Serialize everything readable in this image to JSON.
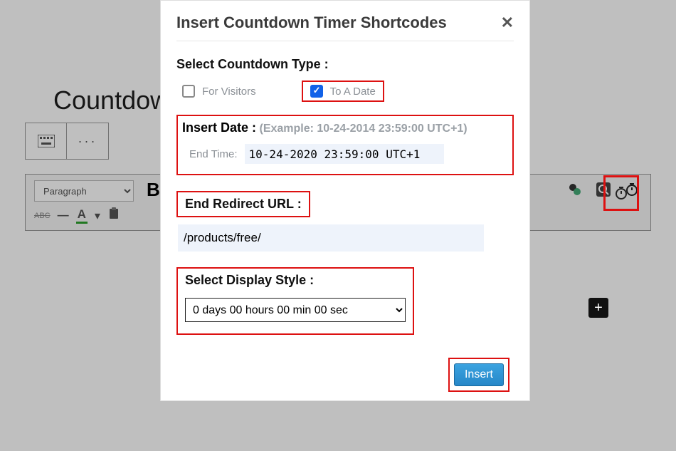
{
  "page": {
    "title": "Countdown"
  },
  "toolbar": {
    "format_selected": "Paragraph",
    "abc_text": "ABC",
    "underline_A": "A"
  },
  "modal": {
    "title": "Insert Countdown Timer Shortcodes",
    "select_type_label": "Select Countdown Type :",
    "opt_visitors": "For Visitors",
    "opt_to_date": "To A Date",
    "insert_date_label": "Insert Date :",
    "insert_date_example": "(Example: 10-24-2014 23:59:00 UTC+1)",
    "end_time_label": "End Time:",
    "end_time_value": "10-24-2020 23:59:00 UTC+1",
    "redirect_label": "End Redirect URL :",
    "redirect_value": "/products/free/",
    "style_label": "Select Display Style :",
    "style_value": "0 days 00 hours 00 min 00 sec",
    "insert_btn": "Insert"
  }
}
